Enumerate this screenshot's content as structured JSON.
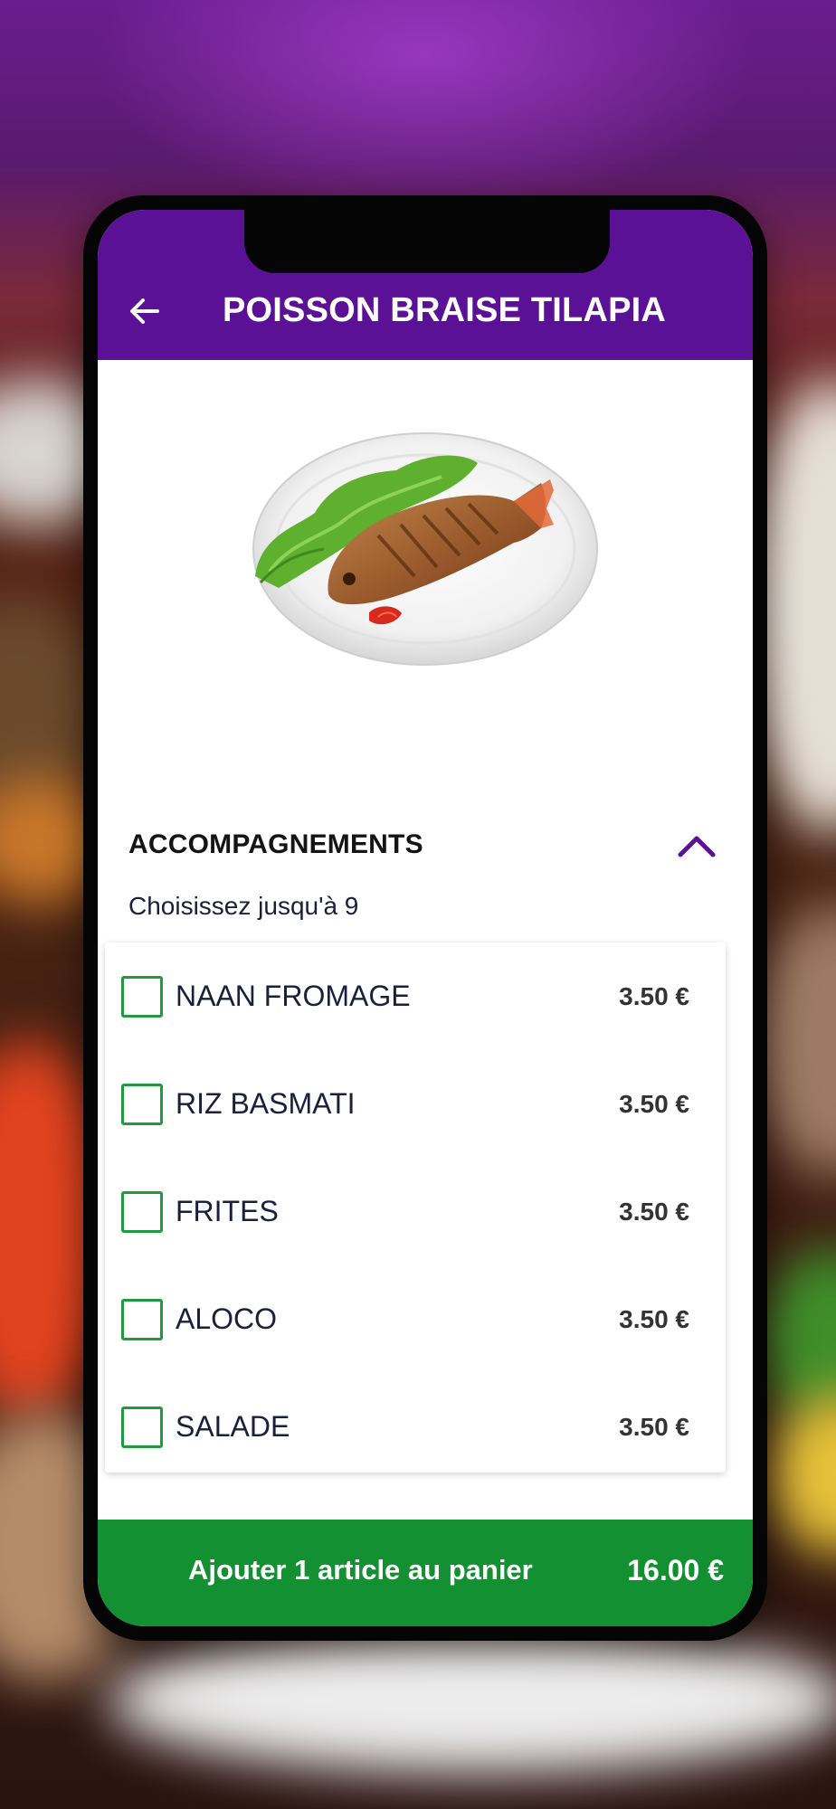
{
  "app_bar": {
    "title": "POISSON BRAISE TILAPIA",
    "back_icon": "arrow-left-icon",
    "background": "#5b1195"
  },
  "hero_image": "grilled-tilapia-plate",
  "section": {
    "title": "ACCOMPAGNEMENTS",
    "collapse_icon": "chevron-up-icon",
    "hint": "Choisissez jusqu'à 9"
  },
  "options": [
    {
      "label": "NAAN FROMAGE",
      "price": "3.50 €",
      "checked": false
    },
    {
      "label": "RIZ BASMATI",
      "price": "3.50 €",
      "checked": false
    },
    {
      "label": "FRITES",
      "price": "3.50 €",
      "checked": false
    },
    {
      "label": "ALOCO",
      "price": "3.50 €",
      "checked": false
    },
    {
      "label": "SALADE",
      "price": "3.50 €",
      "checked": false
    }
  ],
  "cart": {
    "label": "Ajouter 1 article au panier",
    "total": "16.00 €",
    "background": "#139032"
  },
  "colors": {
    "primary": "#5b1195",
    "accent_green": "#1f9a3f"
  }
}
